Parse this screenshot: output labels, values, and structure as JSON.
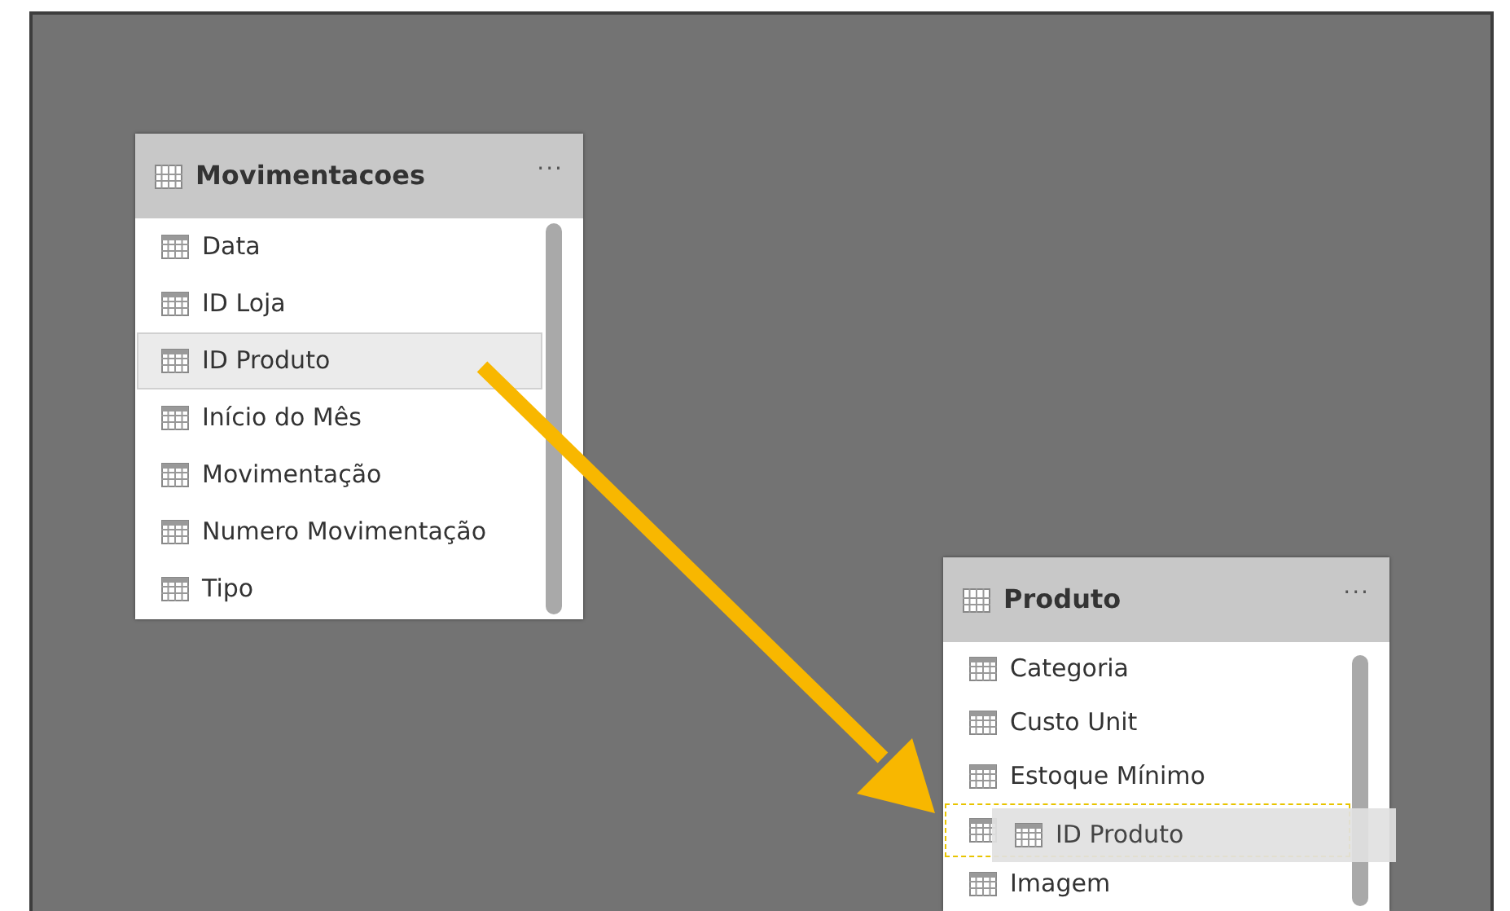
{
  "tables": [
    {
      "title": "Movimentacoes",
      "more": "···",
      "fields": [
        {
          "label": "Data",
          "selected": false,
          "kind": "field"
        },
        {
          "label": "ID Loja",
          "selected": false,
          "kind": "field"
        },
        {
          "label": "ID Produto",
          "selected": true,
          "kind": "field"
        },
        {
          "label": "Início do Mês",
          "selected": false,
          "kind": "field"
        },
        {
          "label": "Movimentação",
          "selected": false,
          "kind": "field"
        },
        {
          "label": "Numero Movimentação",
          "selected": false,
          "kind": "field"
        },
        {
          "label": "Tipo",
          "selected": false,
          "kind": "field"
        }
      ]
    },
    {
      "title": "Produto",
      "more": "···",
      "fields": [
        {
          "label": "Categoria",
          "selected": false,
          "kind": "field"
        },
        {
          "label": "Custo Unit",
          "selected": false,
          "kind": "field"
        },
        {
          "label": "Estoque Mínimo",
          "selected": false,
          "kind": "field"
        },
        {
          "selected": false,
          "kind": "drop-target"
        },
        {
          "label": "Imagem",
          "selected": false,
          "kind": "field"
        }
      ]
    }
  ],
  "drag_ghost": {
    "label": "ID Produto"
  }
}
